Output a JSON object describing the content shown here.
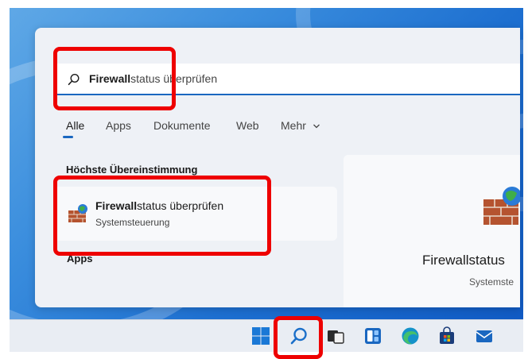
{
  "search": {
    "query_bold": "Firewall",
    "query_rest": "status überprüfen"
  },
  "tabs": [
    {
      "label": "Alle"
    },
    {
      "label": "Apps"
    },
    {
      "label": "Dokumente"
    },
    {
      "label": "Web"
    },
    {
      "label": "Mehr"
    }
  ],
  "sections": {
    "best_match": "Höchste Übereinstimmung",
    "apps": "Apps"
  },
  "best_match": {
    "title_bold": "Firewall",
    "title_rest": "status überprüfen",
    "subtitle": "Systemsteuerung"
  },
  "preview": {
    "title": "Firewallstatus",
    "subtitle": "Systemste"
  },
  "taskbar": {
    "icons": [
      "windows-start-icon",
      "search-icon",
      "task-view-icon",
      "widgets-icon",
      "edge-icon",
      "store-icon",
      "mail-icon"
    ]
  },
  "colors": {
    "accent": "#1a67c0",
    "highlight": "#ee0000"
  }
}
